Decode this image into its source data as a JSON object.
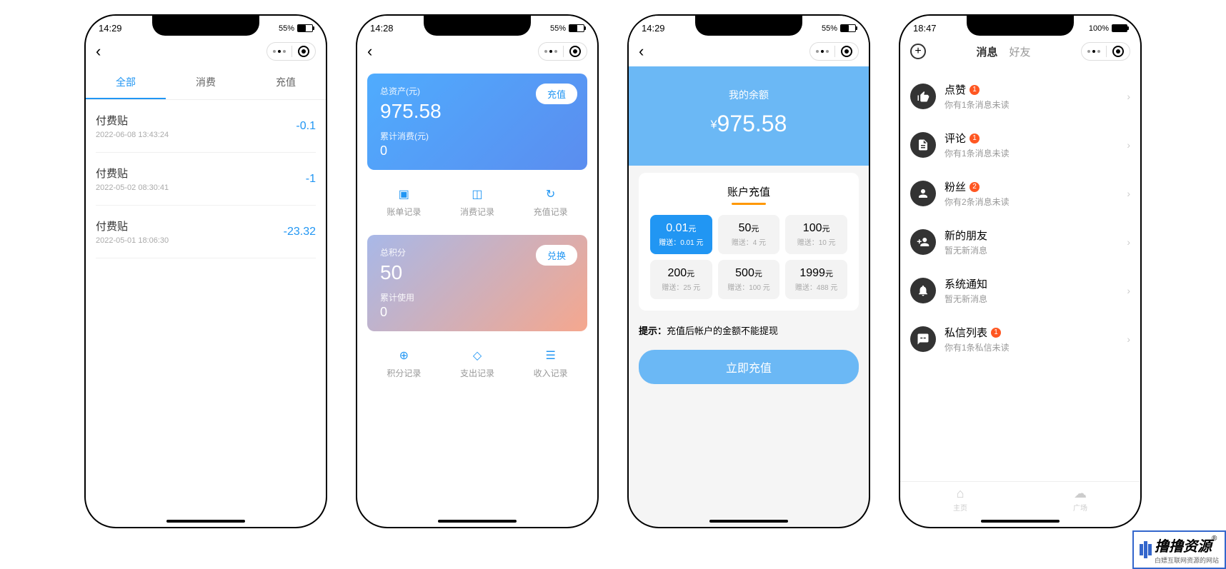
{
  "screen1": {
    "time": "14:29",
    "battery": "55%",
    "tabs": [
      "全部",
      "消费",
      "充值"
    ],
    "transactions": [
      {
        "title": "付费贴",
        "time": "2022-06-08 13:43:24",
        "amount": "-0.1"
      },
      {
        "title": "付费贴",
        "time": "2022-05-02 08:30:41",
        "amount": "-1"
      },
      {
        "title": "付费贴",
        "time": "2022-05-01 18:06:30",
        "amount": "-23.32"
      }
    ]
  },
  "screen2": {
    "time": "14:28",
    "battery": "55%",
    "assets": {
      "label": "总资产(元)",
      "value": "975.58",
      "sub_label": "累计消费(元)",
      "sub_value": "0",
      "btn": "充值"
    },
    "asset_actions": [
      "账单记录",
      "消费记录",
      "充值记录"
    ],
    "points": {
      "label": "总积分",
      "value": "50",
      "sub_label": "累计使用",
      "sub_value": "0",
      "btn": "兑换"
    },
    "point_actions": [
      "积分记录",
      "支出记录",
      "收入记录"
    ]
  },
  "screen3": {
    "time": "14:29",
    "battery": "55%",
    "balance_label": "我的余额",
    "balance_value": "975.58",
    "recharge_title": "账户充值",
    "options": [
      {
        "amount": "0.01",
        "unit": "元",
        "bonus": "赠送：0.01 元"
      },
      {
        "amount": "50",
        "unit": "元",
        "bonus": "赠送：4 元"
      },
      {
        "amount": "100",
        "unit": "元",
        "bonus": "赠送：10 元"
      },
      {
        "amount": "200",
        "unit": "元",
        "bonus": "赠送：25 元"
      },
      {
        "amount": "500",
        "unit": "元",
        "bonus": "赠送：100 元"
      },
      {
        "amount": "1999",
        "unit": "元",
        "bonus": "赠送：488 元"
      }
    ],
    "hint_label": "提示：",
    "hint_text": "充值后帐户的金额不能提现",
    "recharge_btn": "立即充值"
  },
  "screen4": {
    "time": "18:47",
    "battery": "100%",
    "tabs": [
      "消息",
      "好友"
    ],
    "items": [
      {
        "icon": "👍",
        "title": "点赞",
        "badge": "1",
        "sub": "你有1条消息未读"
      },
      {
        "icon": "📄",
        "title": "评论",
        "badge": "1",
        "sub": "你有1条消息未读"
      },
      {
        "icon": "👤",
        "title": "粉丝",
        "badge": "2",
        "sub": "你有2条消息未读"
      },
      {
        "icon": "+👤",
        "title": "新的朋友",
        "badge": "",
        "sub": "暂无新消息"
      },
      {
        "icon": "🔔",
        "title": "系统通知",
        "badge": "",
        "sub": "暂无新消息"
      },
      {
        "icon": "💬",
        "title": "私信列表",
        "badge": "1",
        "sub": "你有1条私信未读"
      }
    ],
    "bottom_nav": [
      "主页",
      "广场"
    ]
  },
  "watermark": {
    "name": "撸撸资源",
    "sub": "白嫖互联网资源的网站"
  }
}
